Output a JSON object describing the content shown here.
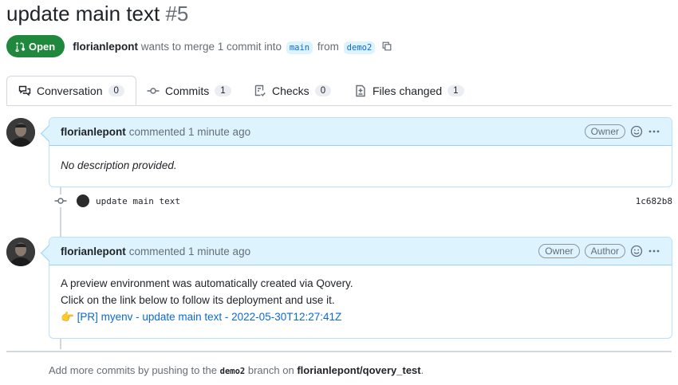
{
  "pr": {
    "title": "update main text",
    "number": "#5",
    "status": "Open",
    "author": "florianlepont",
    "merge_text": "wants to merge 1 commit into",
    "base_branch": "main",
    "from_text": "from",
    "head_branch": "demo2"
  },
  "tabs": [
    {
      "label": "Conversation",
      "count": "0",
      "icon": "comment-discussion-icon"
    },
    {
      "label": "Commits",
      "count": "1",
      "icon": "git-commit-icon"
    },
    {
      "label": "Checks",
      "count": "0",
      "icon": "checklist-icon"
    },
    {
      "label": "Files changed",
      "count": "1",
      "icon": "file-diff-icon"
    }
  ],
  "comments": [
    {
      "author": "florianlepont",
      "action": "commented 1 minute ago",
      "roles": [
        "Owner"
      ],
      "body": [
        "No description provided."
      ]
    },
    {
      "author": "florianlepont",
      "action": "commented 1 minute ago",
      "roles": [
        "Owner",
        "Author"
      ],
      "body": [
        "A preview environment was automatically created via Qovery.",
        "Click on the link below to follow its deployment and use it."
      ],
      "link_emoji": "👉",
      "link_text": "[PR] myenv - update main text - 2022-05-30T12:27:41Z"
    }
  ],
  "commit": {
    "message": "update main text",
    "sha": "1c682b8"
  },
  "footer": {
    "prefix": "Add more commits by pushing to the",
    "branch": "demo2",
    "middle": "branch on",
    "repo": "florianlepont/qovery_test",
    "suffix": "."
  },
  "colors": {
    "open_green": "#1f883d",
    "link_blue": "#0969da",
    "comment_header": "#ddf4ff"
  }
}
